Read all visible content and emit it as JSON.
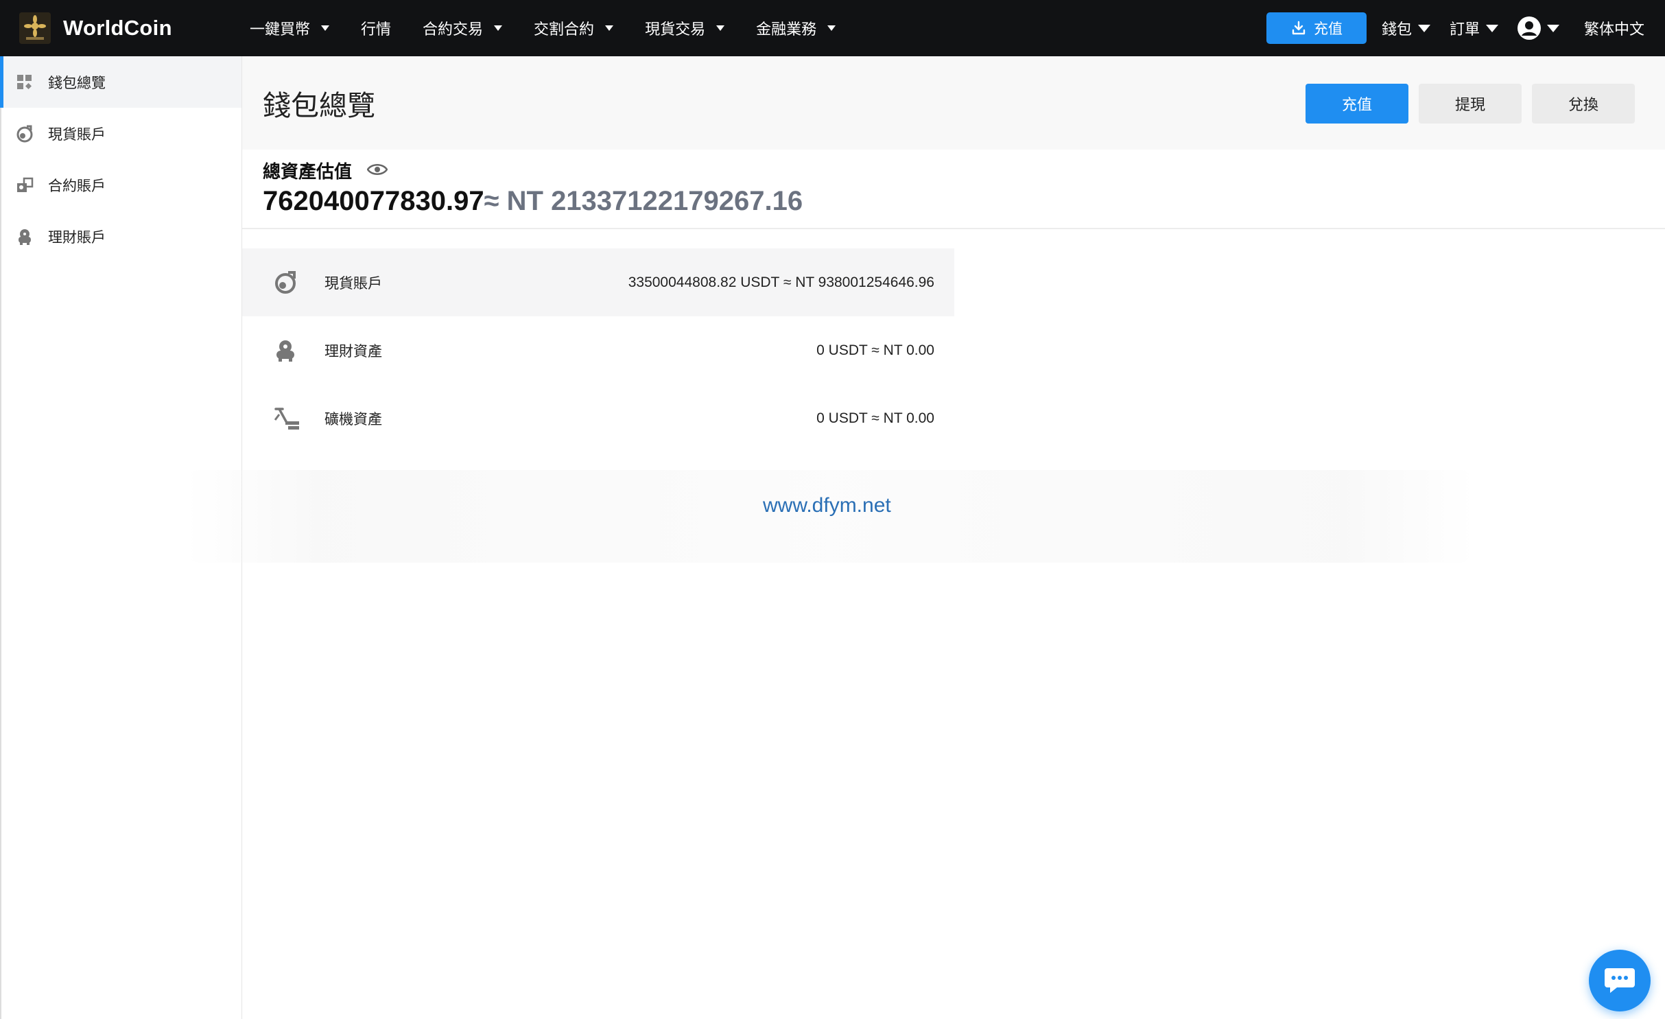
{
  "header": {
    "brand_name": "WorldCoin",
    "nav": [
      {
        "label": "一鍵買幣",
        "has_dropdown": true
      },
      {
        "label": "行情",
        "has_dropdown": false
      },
      {
        "label": "合約交易",
        "has_dropdown": true
      },
      {
        "label": "交割合約",
        "has_dropdown": true
      },
      {
        "label": "現貨交易",
        "has_dropdown": true
      },
      {
        "label": "金融業務",
        "has_dropdown": true
      }
    ],
    "deposit_label": "充值",
    "wallet_label": "錢包",
    "orders_label": "訂單",
    "language_label": "繁体中文"
  },
  "sidebar": {
    "items": [
      {
        "label": "錢包總覽",
        "icon": "dashboard-grid-icon",
        "active": true
      },
      {
        "label": "現貨賬戶",
        "icon": "spot-account-icon",
        "active": false
      },
      {
        "label": "合約賬戶",
        "icon": "contract-account-icon",
        "active": false
      },
      {
        "label": "理財賬戶",
        "icon": "finance-account-icon",
        "active": false
      }
    ]
  },
  "main": {
    "title": "錢包總覽",
    "buttons": {
      "deposit": "充值",
      "withdraw": "提現",
      "exchange": "兌換"
    },
    "total": {
      "label": "總資產估值",
      "usdt_value": "762040077830.97",
      "nt_value": "≈ NT 21337122179267.16"
    },
    "accounts": [
      {
        "name": "現貨賬戶",
        "value": "33500044808.82 USDT ≈ NT 938001254646.96",
        "icon": "spot-account-icon",
        "highlighted": true
      },
      {
        "name": "理財資產",
        "value": "0 USDT ≈ NT 0.00",
        "icon": "finance-asset-icon",
        "highlighted": false
      },
      {
        "name": "礦機資產",
        "value": "0 USDT ≈ NT 0.00",
        "icon": "mining-machine-icon",
        "highlighted": false
      }
    ]
  },
  "watermark": "www.dfym.net",
  "colors": {
    "accent": "#1f8ef1",
    "topbar": "#111214",
    "muted_value": "#6b7280"
  }
}
